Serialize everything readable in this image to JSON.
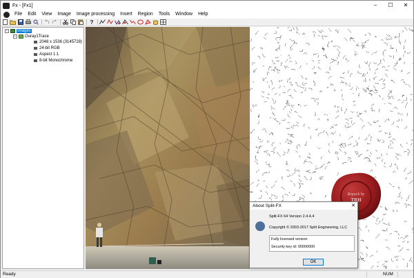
{
  "window": {
    "title": "Fx - [Fx1]",
    "controls": [
      "–",
      "☐",
      "✕"
    ]
  },
  "menu": [
    "File",
    "Edit",
    "View",
    "Image",
    "Image processing",
    "Insert",
    "Region",
    "Tools",
    "Window",
    "Help"
  ],
  "toolbar": {
    "icons": [
      "new-file-icon",
      "open-folder-icon",
      "save-icon",
      "print-icon",
      "preview-icon",
      "undo-icon",
      "redo-icon",
      "cut-icon",
      "copy-icon",
      "paste-icon",
      "help-icon",
      "trace-icon",
      "trace-red-icon",
      "trace-blue-icon",
      "trace-black-icon",
      "stats-icon",
      "rose-icon",
      "region-icon",
      "hand-icon",
      "grid-icon"
    ]
  },
  "tree": {
    "root": "Images",
    "child": "Ouray1Trace",
    "props": [
      "2048 x 1536  (3145728)",
      "24-bit RGB",
      "Aspect 1:1",
      "8-bit Monochrome"
    ]
  },
  "about": {
    "title": "About Split-FX",
    "version": "Split-FX 64",
    "version_suffix": "Version 2.4.4.4",
    "copyright": "Copyright © 2003-2017 Split Engineering, LLC",
    "licensed": "Fully licensed version",
    "security": "Security key id:  00000000",
    "ok": "OK"
  },
  "seal": {
    "line1": "Repack by",
    "line2": "TRH"
  },
  "status": {
    "text": "Ready",
    "num": "NUM"
  },
  "colors": {
    "selection": "#0078d7",
    "seal": "#9b1c1f",
    "mdi_background": "#ababab"
  }
}
